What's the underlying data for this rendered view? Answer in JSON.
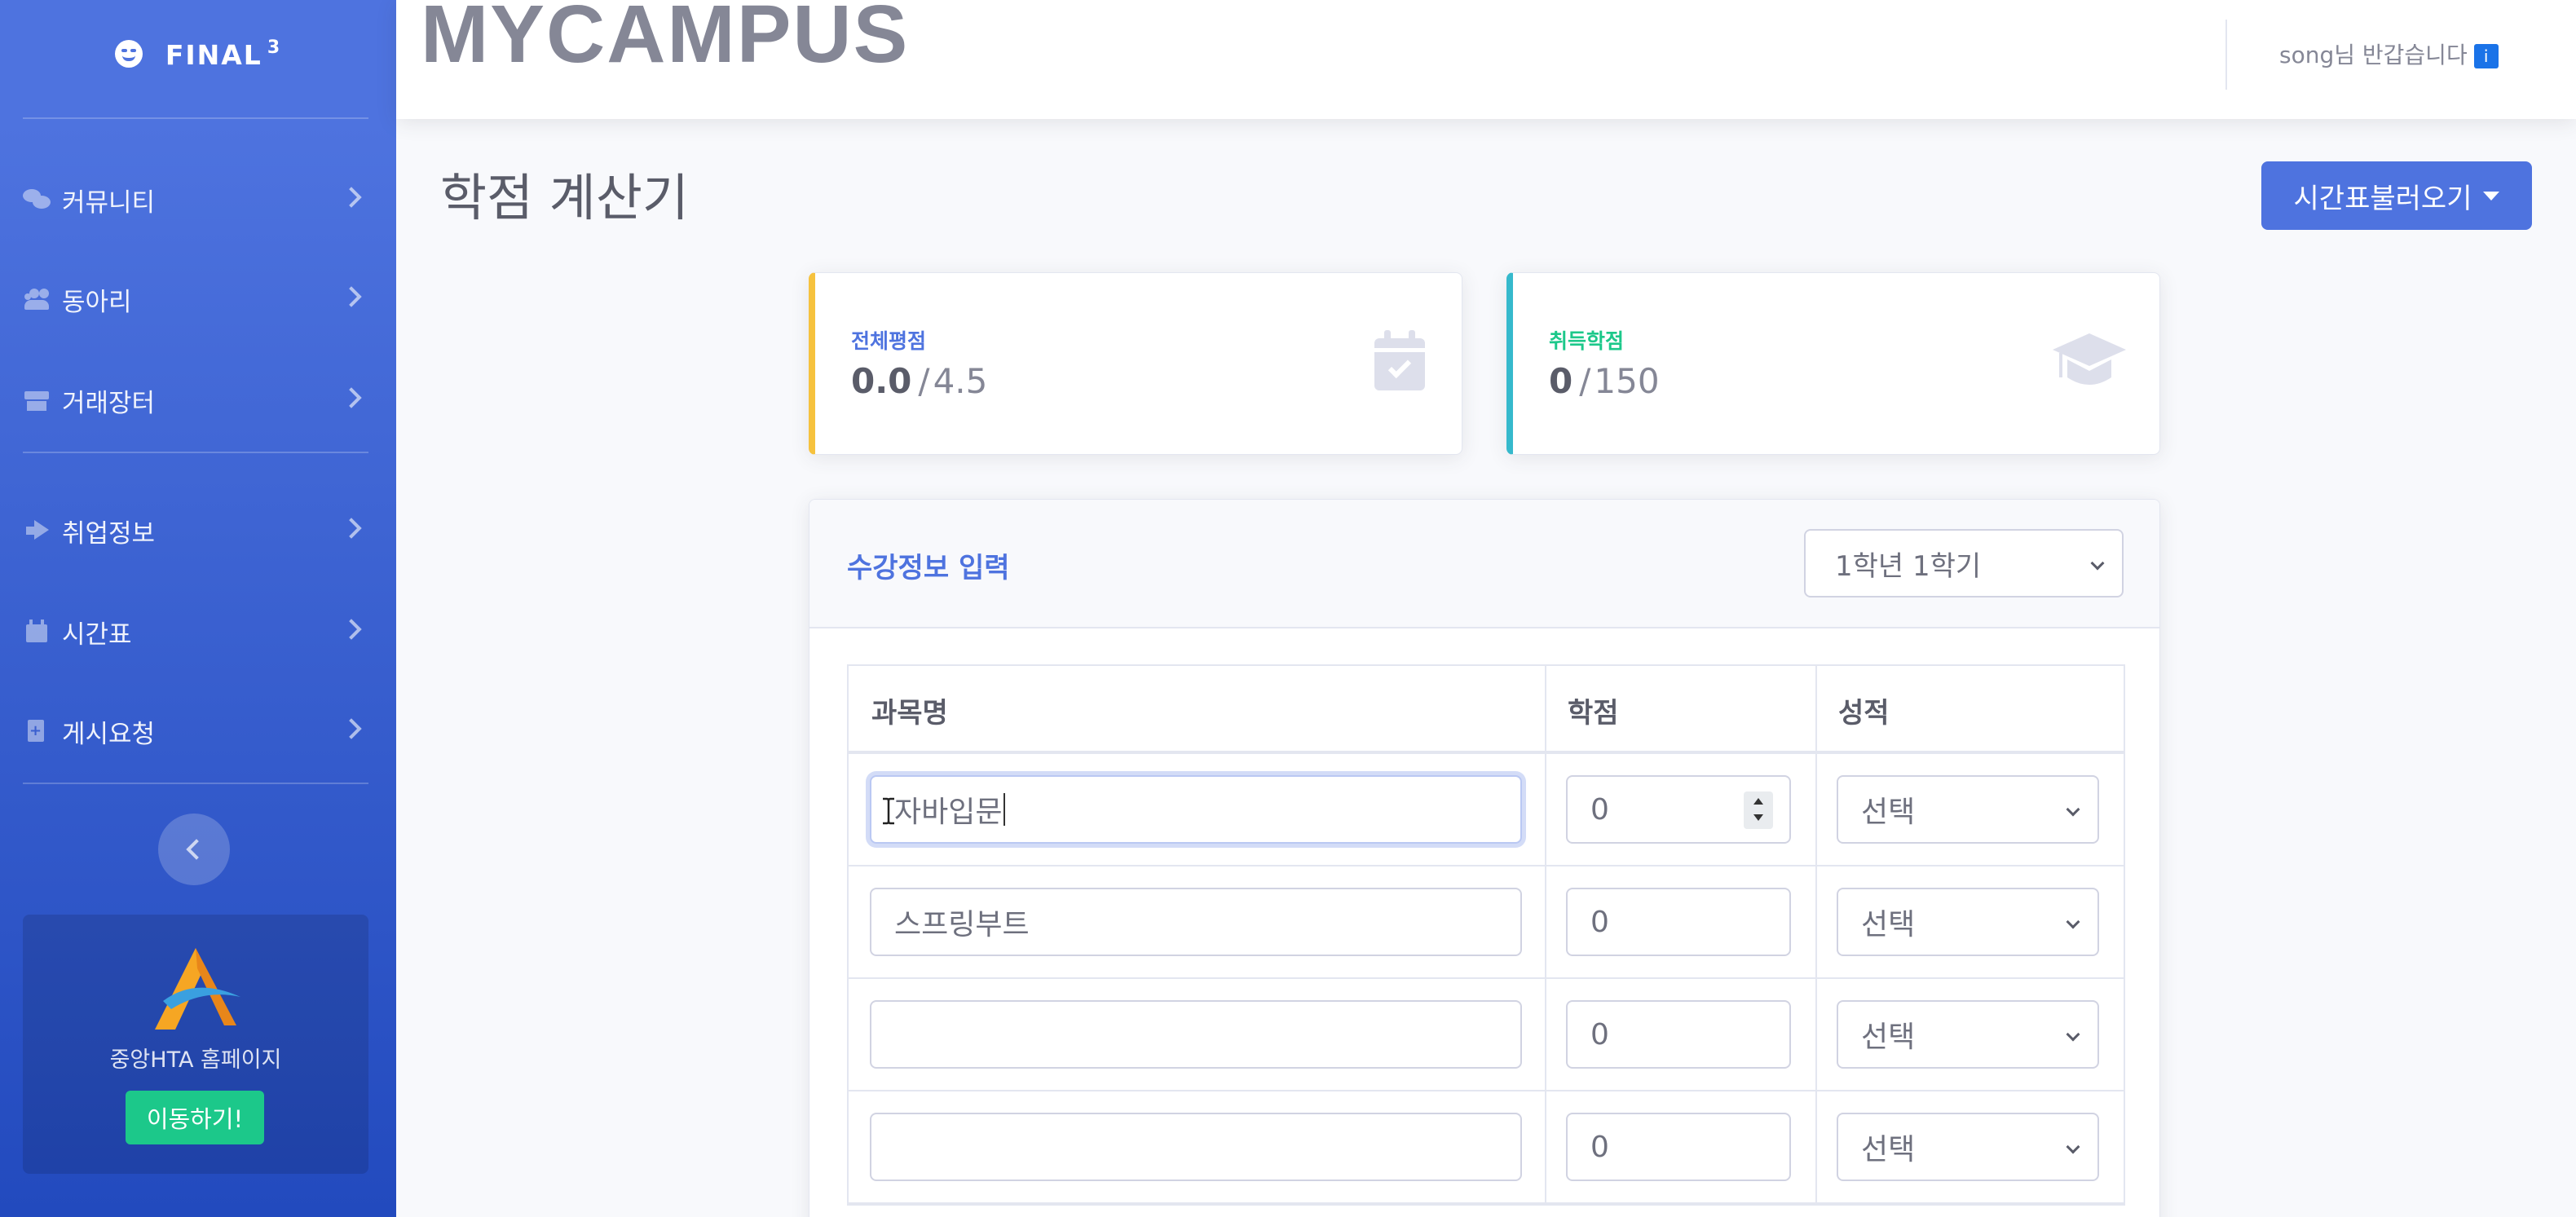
{
  "brand": {
    "name": "FINAL",
    "sup": "3"
  },
  "sidebar": {
    "items": [
      {
        "label": "커뮤니티",
        "icon": "comments-icon"
      },
      {
        "label": "동아리",
        "icon": "users-icon"
      },
      {
        "label": "거래장터",
        "icon": "store-icon"
      },
      {
        "label": "취업정보",
        "icon": "bullhorn-icon"
      },
      {
        "label": "시간표",
        "icon": "calendar-icon"
      },
      {
        "label": "게시요청",
        "icon": "file-plus-icon"
      }
    ],
    "promo": {
      "text": "중앙HTA 홈페이지",
      "button": "이동하기!"
    }
  },
  "topbar": {
    "logo": "MYCAMPUS",
    "user_greeting": "song님 반갑습니다",
    "user_badge": "i"
  },
  "page": {
    "title": "학점 계산기",
    "load_button": "시간표불러오기"
  },
  "stats": {
    "gpa": {
      "label": "전체평점",
      "value": "0.0",
      "max": "4.5"
    },
    "credits": {
      "label": "취득학점",
      "value": "0",
      "max": "150"
    }
  },
  "course_input": {
    "title": "수강정보 입력",
    "semester": "1학년 1학기",
    "columns": [
      "과목명",
      "학점",
      "성적"
    ],
    "rows": [
      {
        "subject": "자바입문",
        "credit": "0",
        "grade": "선택"
      },
      {
        "subject": "스프링부트",
        "credit": "0",
        "grade": "선택"
      },
      {
        "subject": "",
        "credit": "0",
        "grade": "선택"
      },
      {
        "subject": "",
        "credit": "0",
        "grade": "선택"
      }
    ]
  },
  "colors": {
    "primary": "#4e73df",
    "success": "#1cc88a",
    "warning": "#f6c23e",
    "info": "#36b9cc"
  }
}
